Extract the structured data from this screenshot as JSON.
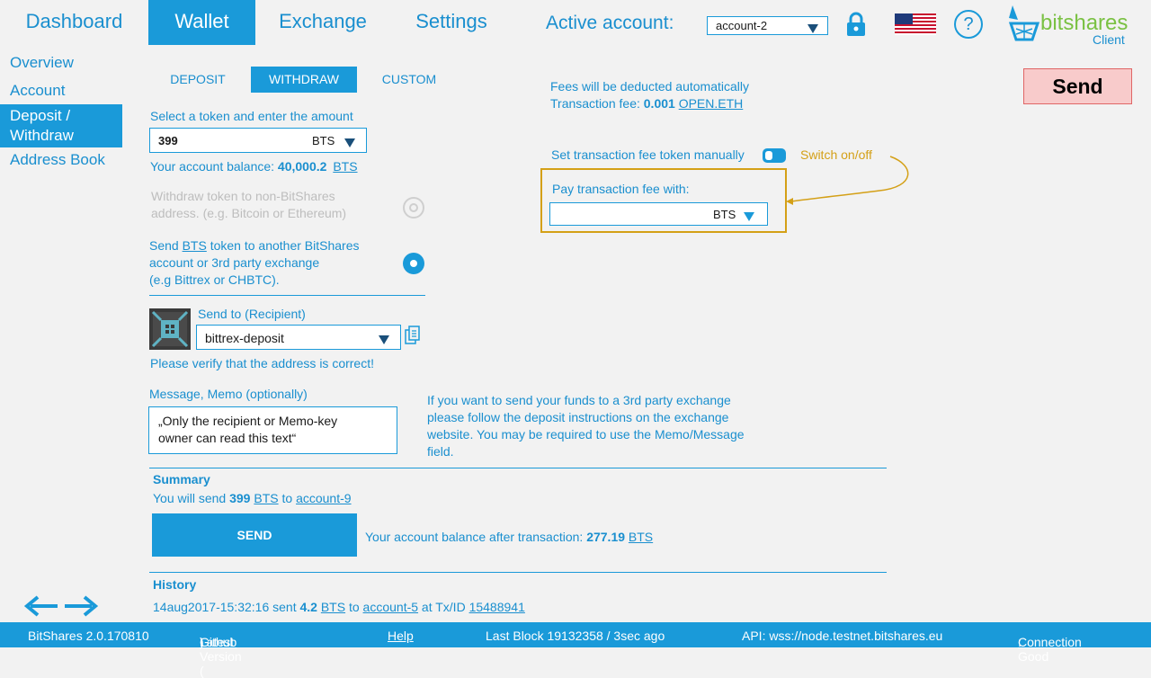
{
  "nav": {
    "tabs": [
      "Dashboard",
      "Wallet",
      "Exchange",
      "Settings"
    ],
    "active_account_label": "Active account:",
    "active_account_value": "account-2",
    "logo_main": "bitshares",
    "logo_sub": "Client",
    "help_glyph": "?"
  },
  "sidebar": {
    "items": [
      "Overview",
      "Account",
      "Deposit / Withdraw",
      "Address Book"
    ]
  },
  "send_button": "Send",
  "subtabs": [
    "DEPOSIT",
    "WITHDRAW",
    "CUSTOM"
  ],
  "token": {
    "label": "Select a token  and enter the amount",
    "amount": "399",
    "symbol": "BTS",
    "balance_label": "Your account balance:",
    "balance_value": "40,000.2",
    "balance_symbol": "BTS"
  },
  "options": {
    "nonbts_line1": "Withdraw token to non-BitShares",
    "nonbts_line2": "address. (e.g. Bitcoin or Ethereum)",
    "bts_prefix": "Send",
    "bts_token": "BTS",
    "bts_line1_rest": "token to another BitShares",
    "bts_line2": "account or 3rd party exchange",
    "bts_line3": "(e.g Bittrex or CHBTC)."
  },
  "recipient": {
    "label": "Send to (Recipient)",
    "value": "bittrex-deposit",
    "verify": "Please verify that the address is correct!"
  },
  "memo": {
    "label": "Message, Memo (optionally)",
    "line1": "„Only the recipient or Memo-key",
    "line2": "owner can read this text“"
  },
  "exchange_note": {
    "line1": "If you want to send your funds to a 3rd party exchange",
    "line2": "please follow the deposit instructions on the exchange",
    "line3": "website. You may be required to use the Memo/Message",
    "line4": "field."
  },
  "fees": {
    "auto": "Fees will be deducted automatically",
    "fee_label": "Transaction fee:",
    "fee_value": "0.001",
    "fee_token": "OPEN.ETH",
    "manual_label": "Set transaction fee token manually",
    "switch_note": "Switch on/off",
    "pay_label": "Pay transaction fee with:",
    "pay_token": "BTS"
  },
  "summary": {
    "title": "Summary",
    "prefix": "You will send",
    "amount": "399",
    "symbol": "BTS",
    "to": "to",
    "recipient": "account-9",
    "button": "SEND",
    "after_label": "Your account balance after transaction:",
    "after_value": "277.19",
    "after_symbol": "BTS"
  },
  "history": {
    "title": "History",
    "date": "14aug2017-15:32:16",
    "sent": "sent",
    "amount": "4.2",
    "symbol": "BTS",
    "to": "to",
    "account": "account-5",
    "at": "at Tx/ID",
    "txid": "15488941"
  },
  "footer": {
    "version": "BitShares 2.0.170810",
    "latest_prefix": "Latest Version (",
    "latest_link": "Github",
    "latest_suffix": ")",
    "help": "Help",
    "block": "Last Block 19132358  / 3sec ago",
    "api": "API:  wss://node.testnet.bitshares.eu",
    "connection_label": "Connection",
    "connection_value": ": Good"
  },
  "colors": {
    "accent": "#1a9ad9",
    "highlight": "#d4a017",
    "send_bg": "#f8cbcb",
    "send_border": "#e06666"
  },
  "icons": [
    "lock-icon",
    "us-flag-icon",
    "help-icon",
    "bitshares-logo-icon",
    "copy-icon",
    "identicon",
    "arrow-left-icon",
    "arrow-right-icon"
  ]
}
